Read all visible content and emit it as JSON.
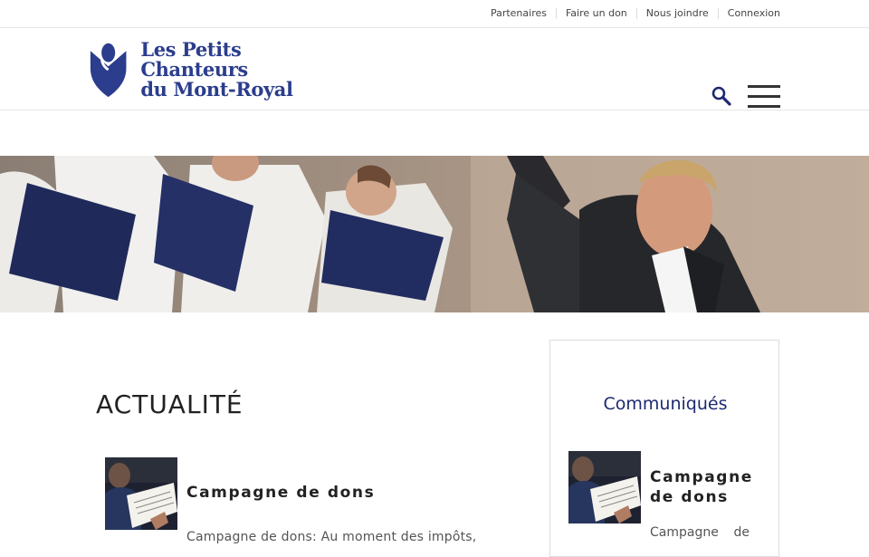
{
  "topnav": {
    "items": [
      "Partenaires",
      "Faire un don",
      "Nous joindre",
      "Connexion"
    ]
  },
  "header": {
    "logo_line1": "Les Petits Chanteurs",
    "logo_line2": "du Mont-Royal",
    "icons": {
      "search": "search-icon",
      "menu": "hamburger-menu-icon"
    }
  },
  "colors": {
    "brand": "#2b3d8c",
    "widget_title": "#1d2a70"
  },
  "main": {
    "title": "ACTUALITÉ",
    "post": {
      "title": "Campagne de dons",
      "excerpt": "Campagne de dons: Au moment des impôts,"
    }
  },
  "sidebar": {
    "widget_title": "Communiqués",
    "post": {
      "title": "Campagne de dons",
      "excerpt_word1": "Campagne",
      "excerpt_word2": "de"
    }
  }
}
